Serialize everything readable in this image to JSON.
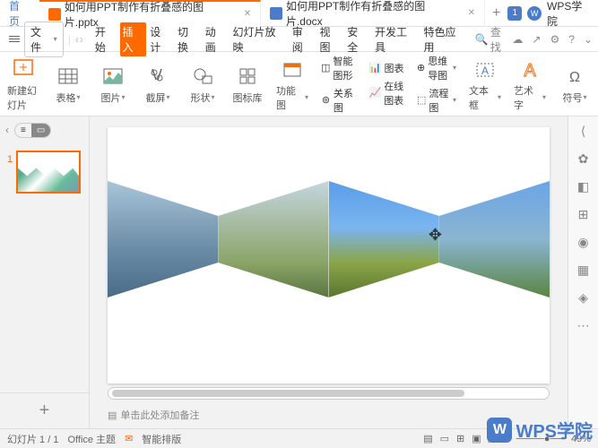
{
  "titlebar": {
    "home": "首页",
    "tab1": "如何用PPT制作有折叠感的图片.pptx",
    "tab2": "如何用PPT制作有折叠感的图片.docx",
    "badge": "1",
    "academy": "WPS学院"
  },
  "menu": {
    "file": "文件",
    "items": [
      "开始",
      "插入",
      "设计",
      "切换",
      "动画",
      "幻灯片放映",
      "审阅",
      "视图",
      "安全",
      "开发工具",
      "特色应用"
    ],
    "active_index": 1,
    "search": "查找"
  },
  "ribbon": {
    "new_slide": "新建幻灯片",
    "table": "表格",
    "picture": "图片",
    "screenshot": "截屏",
    "shape": "形状",
    "icon_lib": "图标库",
    "feature": "功能图",
    "smart_shape": "智能图形",
    "chart": "图表",
    "relation": "关系图",
    "online_chart": "在线图表",
    "mindmap": "思维导图",
    "flowchart": "流程图",
    "textbox": "文本框",
    "wordart": "艺术字",
    "symbol": "符号"
  },
  "thumbnail": {
    "num": "1"
  },
  "notes": "单击此处添加备注",
  "status": {
    "slide_count": "幻灯片 1 / 1",
    "office_theme": "Office 主题",
    "smart_layout": "智能排版",
    "zoom": "49%"
  },
  "watermark": "WPS学院"
}
